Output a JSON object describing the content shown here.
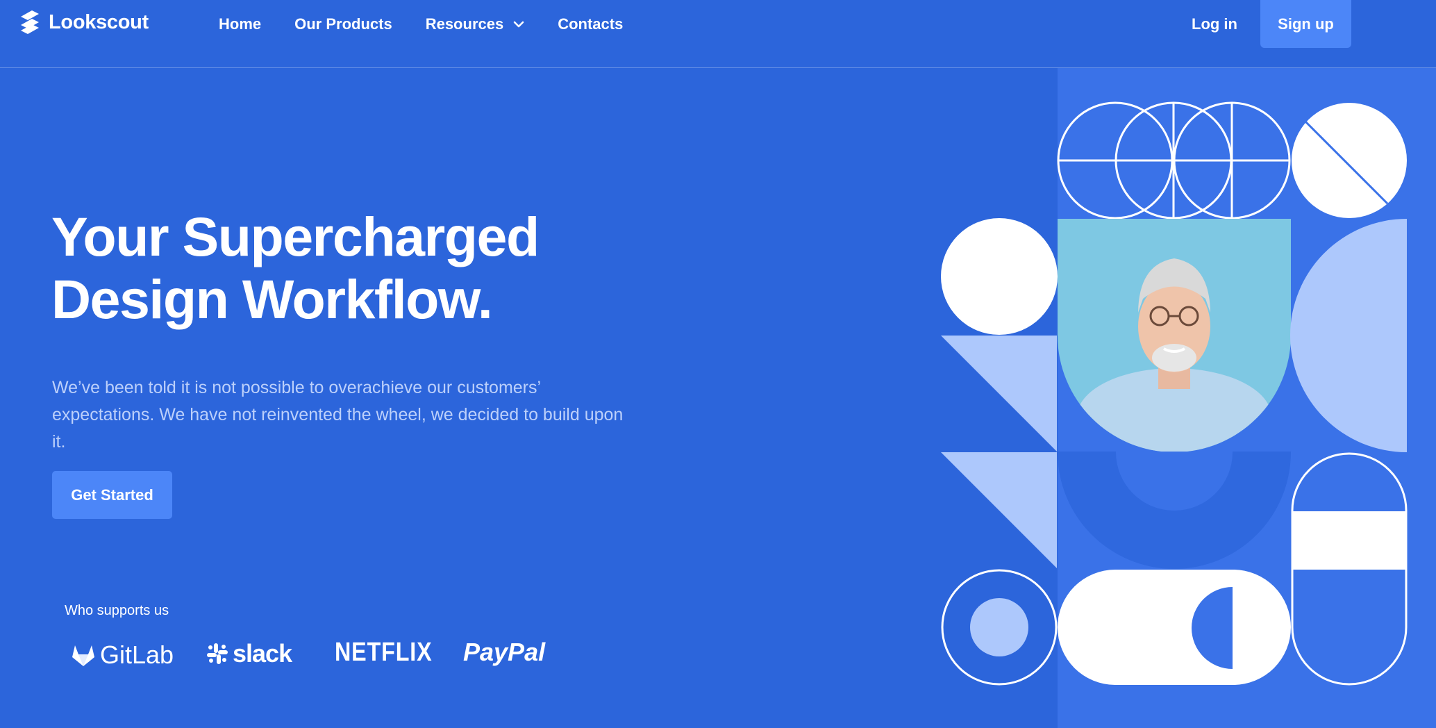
{
  "nav": {
    "brand": "Lookscout",
    "links": [
      {
        "label": "Home"
      },
      {
        "label": "Our Products"
      },
      {
        "label": "Resources",
        "has_dropdown": true
      },
      {
        "label": "Contacts"
      }
    ],
    "login_label": "Log in",
    "signup_label": "Sign up"
  },
  "hero": {
    "title_line1": "Your Supercharged",
    "title_line2": "Design Workflow.",
    "subtitle": "We’ve been told it is not possible to overachieve our customers’ expectations. We have not reinvented the wheel, we decided to build upon it.",
    "cta_label": "Get Started"
  },
  "supporters": {
    "label": "Who supports us",
    "logos": [
      {
        "name": "GitLab",
        "icon": "gitlab-icon"
      },
      {
        "name": "slack",
        "icon": "slack-icon"
      },
      {
        "name": "NETFLIX"
      },
      {
        "name": "PayPal"
      }
    ]
  },
  "colors": {
    "background": "#2c65db",
    "accent": "#4c86f8",
    "panel": "#3a72e8",
    "light_shape": "#adc8fc",
    "white": "#ffffff",
    "photo_bg": "#7ec8e3"
  }
}
